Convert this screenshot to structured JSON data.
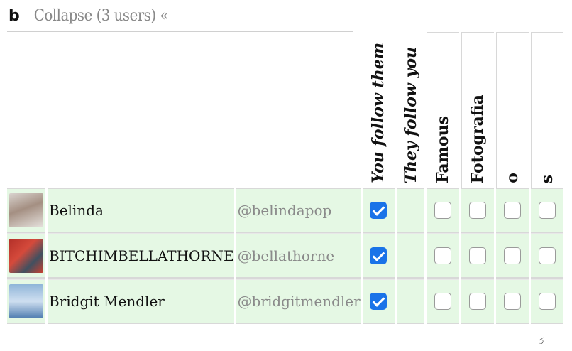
{
  "group": {
    "letter": "b",
    "collapse_label": "Collapse (3 users) «"
  },
  "columns": {
    "you_follow_them": "You follow them",
    "they_follow_you": "They follow you",
    "famous": "Famous",
    "fotografia": "Fotografia",
    "o": "o",
    "s": "s"
  },
  "users": [
    {
      "name": "Belinda",
      "handle": "@belindapop",
      "avatar": "avatar-belinda",
      "you_follow_them": true,
      "they_follow_you": false,
      "famous": false,
      "fotografia": false,
      "o": false,
      "s": false
    },
    {
      "name": "BITCHIMBELLATHORNE",
      "handle": "@bellathorne",
      "avatar": "avatar-bellathorne",
      "you_follow_them": true,
      "they_follow_you": false,
      "famous": false,
      "fotografia": false,
      "o": false,
      "s": false
    },
    {
      "name": "Bridgit Mendler",
      "handle": "@bridgitmendler",
      "avatar": "avatar-bridgitmendler",
      "you_follow_them": true,
      "they_follow_you": false,
      "famous": false,
      "fotografia": false,
      "o": false,
      "s": false
    }
  ],
  "footer": {
    "glyph": "ර"
  }
}
